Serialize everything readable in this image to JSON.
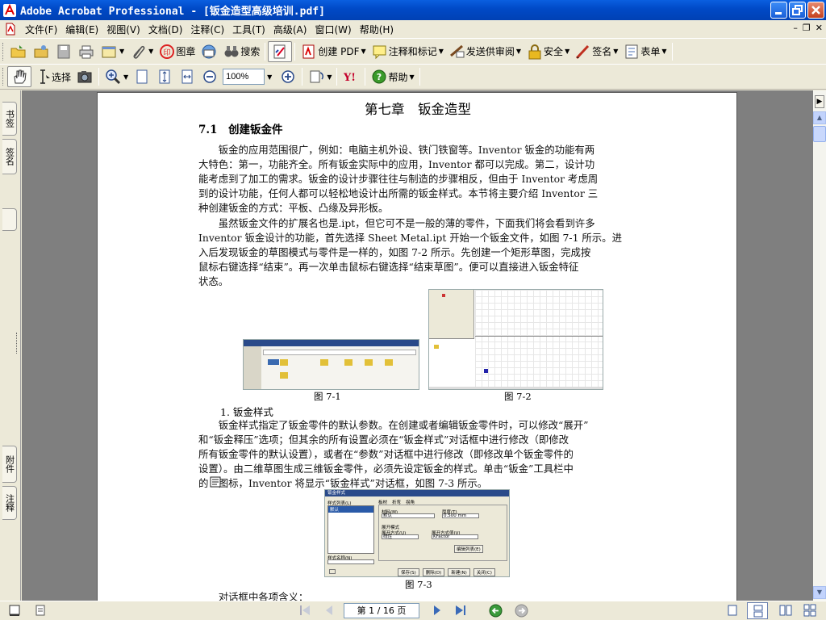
{
  "window": {
    "title": "Adobe Acrobat Professional - [钣金造型高级培训.pdf]"
  },
  "menu": [
    "文件(F)",
    "编辑(E)",
    "视图(V)",
    "文档(D)",
    "注释(C)",
    "工具(T)",
    "高级(A)",
    "窗口(W)",
    "帮助(H)"
  ],
  "toolbar1": {
    "stamp": "图章",
    "search": "搜索",
    "create_pdf": "创建 PDF",
    "comment_markup": "注释和标记",
    "send_review": "发送供审阅",
    "security": "安全",
    "sign": "签名",
    "forms": "表单"
  },
  "toolbar2": {
    "select": "选择",
    "zoom": "100%",
    "help": "帮助"
  },
  "nav_tabs": {
    "bookmarks": "书签",
    "signatures": "签名",
    "attachments": "附件",
    "comments": "注释"
  },
  "doc": {
    "chapter_title": "第七章　钣金造型",
    "section_title": "7.1　创建钣金件",
    "para1": [
      "　　钣金的应用范围很广，例如：电脑主机外设、铁门铁窗等。Inventor 钣金的功能有两",
      "大特色：第一，功能齐全。所有钣金实际中的应用，Inventor 都可以完成。第二，设计功",
      "能考虑到了加工的需求。钣金的设计步骤往往与制造的步骤相反，但由于 Inventor 考虑周",
      "到的设计功能，任何人都可以轻松地设计出所需的钣金样式。本节将主要介绍 Inventor 三",
      "种创建钣金的方式：平板、凸缘及异形板。"
    ],
    "para2": [
      "　　虽然钣金文件的扩展名也是.ipt，但它可不是一般的薄的零件，下面我们将会看到许多",
      "Inventor 钣金设计的功能，首先选择 Sheet Metal.ipt 开始一个钣金文件，如图 7-1 所示。进",
      "入后发现钣金的草图模式与零件是一样的，如图 7-2 所示。先创建一个矩形草图，完成按",
      "鼠标右键选择“结束”。再一次单击鼠标右键选择“结束草图”。便可以直接进入钣金特征",
      "状态。"
    ],
    "fig1": "图 7-1",
    "fig2": "图 7-2",
    "subhead": "1. 钣金样式",
    "para3": [
      "　　钣金样式指定了钣金零件的默认参数。在创建或者编辑钣金零件时，可以修改“展开”",
      "和“钣金释压”选项；但其余的所有设置必须在“钣金样式”对话框中进行修改（即修改",
      "所有钣金零件的默认设置），或者在“参数”对话框中进行修改（即修改单个钣金零件的",
      "设置）。由二维草图生成三维钣金零件，必须先设定钣金的样式。单击“钣金”工具栏中",
      "的　图标，Inventor 将显示“钣金样式”对话框，如图 7-3 所示。"
    ],
    "fig3": "图 7-3",
    "para4": "　　对话框中各项含义：",
    "dialog": {
      "title": "钣金样式",
      "style_list": "样式列表(L)",
      "default": "默认",
      "tab1": "板材",
      "tab2": "折弯",
      "tab3": "拐角",
      "material": "材料(M)",
      "thickness": "厚度(T)",
      "mat_val": "默认",
      "thick_val": "0.500 mm",
      "unfold_label": "展开模式",
      "unfold_method": "展开方式(U)",
      "unfold_val": "线性",
      "unfold_formula": "展开方式值(V)",
      "kfactor": "KFactor",
      "edit_list": "编辑列表(E)",
      "style_name": "样式名称(N)",
      "save": "保存(S)",
      "delete": "删除(D)",
      "new": "新建(N)",
      "close": "关闭(C)"
    }
  },
  "status": {
    "page": "第 1 / 16 页"
  }
}
